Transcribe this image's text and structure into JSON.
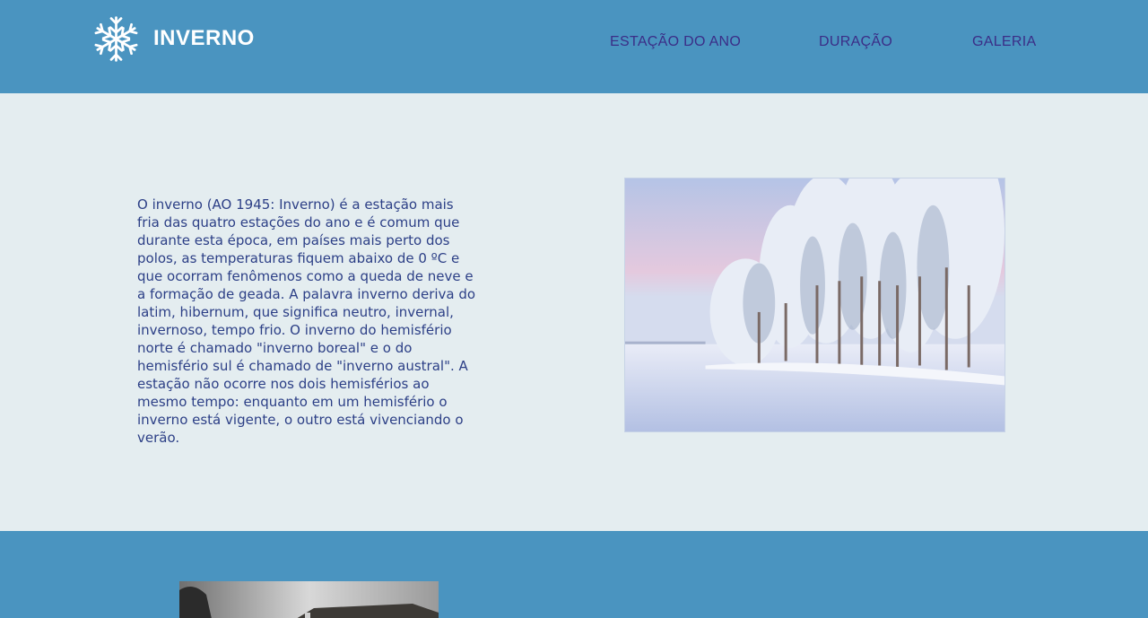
{
  "header": {
    "logo_icon": "snowflake-icon",
    "brand": "INVERNO",
    "nav": [
      {
        "label": "ESTAÇÃO DO ANO"
      },
      {
        "label": "DURAÇÃO"
      },
      {
        "label": "GALERIA"
      }
    ]
  },
  "intro": {
    "paragraph": "O inverno (AO 1945: Inverno) é a estação mais fria das quatro estações do ano e é comum que durante esta época, em países mais perto dos polos, as temperaturas fiquem abaixo de 0 ºC e que ocorram fenômenos como a queda de neve e a formação de geada. A palavra inverno deriva do latim, hibernum, que significa neutro, invernal, invernoso, tempo frio. O inverno do hemisfério norte é chamado \"inverno boreal\" e o do hemisfério sul é chamado de \"inverno austral\". A estação não ocorre nos dois hemisférios ao mesmo tempo: enquanto em um hemisfério o inverno está vigente, o outro está vivenciando o verão."
  },
  "colors": {
    "header_bg": "#4a94c0",
    "page_bg": "#e4edf0",
    "nav_text": "#3b2e87",
    "body_text": "#2c3f86"
  }
}
